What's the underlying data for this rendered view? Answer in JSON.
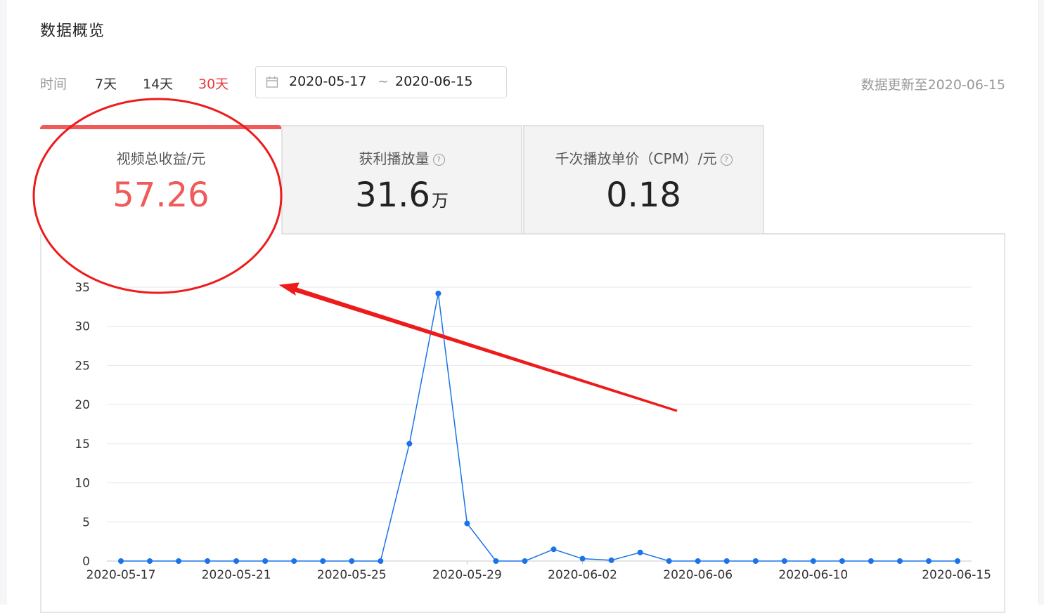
{
  "header": {
    "title": "数据概览"
  },
  "filters": {
    "time_label": "时间",
    "options": [
      "7天",
      "14天",
      "30天"
    ],
    "active_index": 2,
    "date_start": "2020-05-17",
    "date_sep": "~",
    "date_end": "2020-06-15",
    "updated_text": "数据更新至2020-06-15"
  },
  "tabs": [
    {
      "label": "视频总收益/元",
      "value": "57.26",
      "unit": ""
    },
    {
      "label": "获利播放量",
      "value": "31.6",
      "unit": "万"
    },
    {
      "label": "千次播放单价（CPM）/元",
      "value": "0.18",
      "unit": ""
    }
  ],
  "colors": {
    "accent_red": "#ef5a5a",
    "line_blue": "#1a73e8",
    "annotation_red": "#ee1b1b"
  },
  "chart_data": {
    "type": "line",
    "x": [
      "2020-05-17",
      "2020-05-18",
      "2020-05-19",
      "2020-05-20",
      "2020-05-21",
      "2020-05-22",
      "2020-05-23",
      "2020-05-24",
      "2020-05-25",
      "2020-05-26",
      "2020-05-27",
      "2020-05-28",
      "2020-05-29",
      "2020-05-30",
      "2020-05-31",
      "2020-06-01",
      "2020-06-02",
      "2020-06-03",
      "2020-06-04",
      "2020-06-05",
      "2020-06-06",
      "2020-06-07",
      "2020-06-08",
      "2020-06-09",
      "2020-06-10",
      "2020-06-11",
      "2020-06-12",
      "2020-06-13",
      "2020-06-14",
      "2020-06-15"
    ],
    "series": [
      {
        "values": [
          0,
          0,
          0,
          0,
          0,
          0,
          0,
          0,
          0,
          0,
          15,
          34.2,
          4.8,
          0,
          0,
          1.5,
          0.3,
          0.1,
          1.1,
          0,
          0,
          0,
          0,
          0,
          0,
          0,
          0,
          0,
          0,
          0
        ]
      }
    ],
    "xticks": [
      "2020-05-17",
      "2020-05-21",
      "2020-05-25",
      "2020-05-29",
      "2020-06-02",
      "2020-06-06",
      "2020-06-10",
      "2020-06-15"
    ],
    "yticks": [
      0,
      5,
      10,
      15,
      20,
      25,
      30,
      35
    ],
    "ylim": [
      0,
      35
    ],
    "grid": true,
    "xlabel": "",
    "ylabel": ""
  }
}
